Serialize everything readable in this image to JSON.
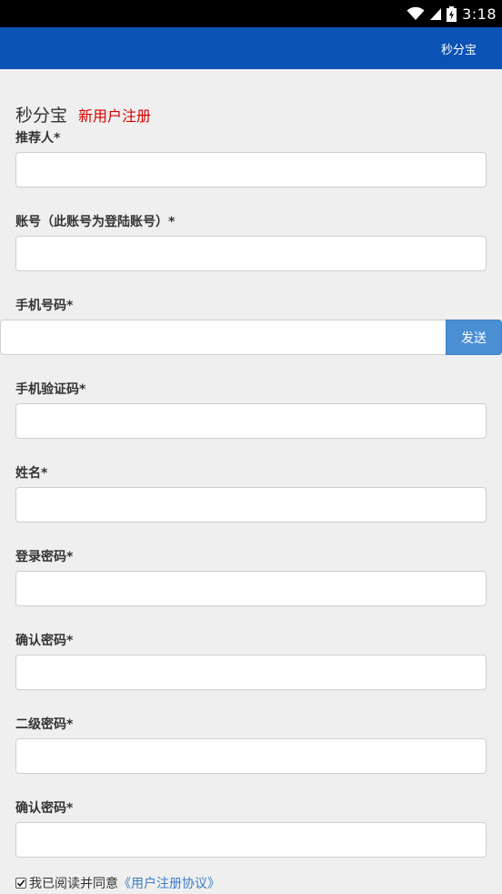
{
  "status_bar": {
    "time": "3:18"
  },
  "app_bar": {
    "title": "秒分宝"
  },
  "heading": {
    "brand": "秒分宝",
    "subtitle": "新用户注册"
  },
  "fields": {
    "referrer": {
      "label": "推荐人*",
      "value": ""
    },
    "account": {
      "label": "账号（此账号为登陆账号）*",
      "value": ""
    },
    "phone": {
      "label": "手机号码*",
      "value": "",
      "send_label": "发送"
    },
    "sms_code": {
      "label": "手机验证码*",
      "value": ""
    },
    "name": {
      "label": "姓名*",
      "value": ""
    },
    "login_password": {
      "label": "登录密码*",
      "value": ""
    },
    "confirm_password": {
      "label": "确认密码*",
      "value": ""
    },
    "secondary_password": {
      "label": "二级密码*",
      "value": ""
    },
    "confirm_secondary_password": {
      "label": "确认密码*",
      "value": ""
    }
  },
  "agreement": {
    "checked": true,
    "text": "我已阅读并同意",
    "link": "《用户注册协议》"
  },
  "colors": {
    "app_bar": "#0a52b5",
    "subtitle": "#d60000",
    "send_button": "#4a8ed4",
    "link": "#3a7dc9"
  },
  "icons": {
    "wifi": "wifi-icon",
    "signal": "signal-icon",
    "battery": "battery-icon",
    "checkbox": "checkbox-checked-icon"
  }
}
